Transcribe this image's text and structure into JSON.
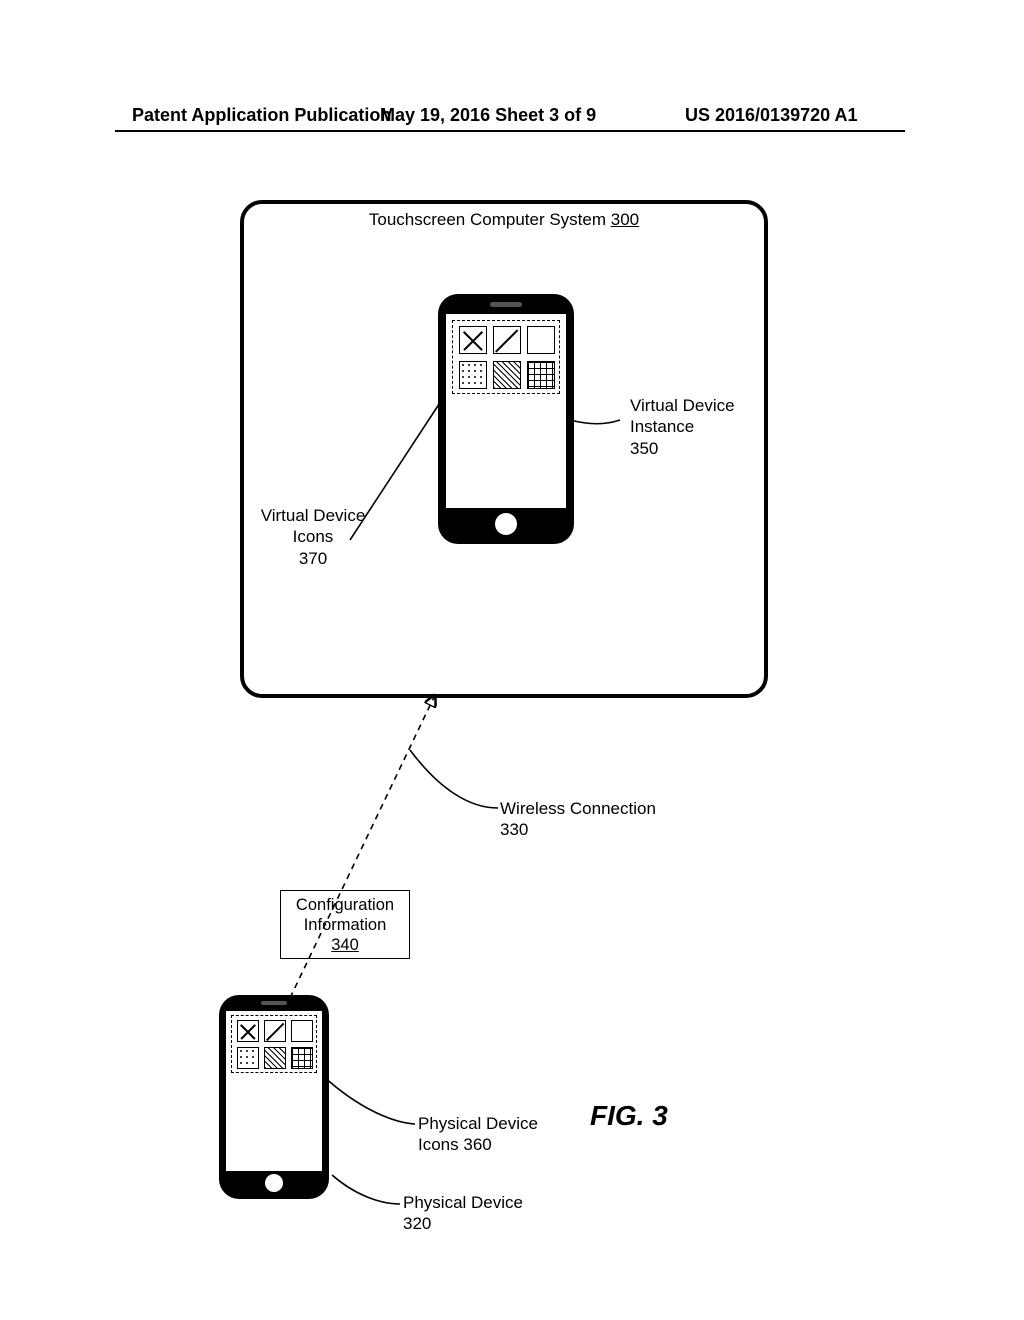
{
  "header": {
    "left": "Patent Application Publication",
    "mid": "May 19, 2016  Sheet 3 of 9",
    "right": "US 2016/0139720 A1"
  },
  "touchscreen": {
    "title_text": "Touchscreen Computer System",
    "title_ref": "300"
  },
  "labels": {
    "virtual_device_instance": {
      "text": "Virtual Device\nInstance",
      "ref": "350"
    },
    "virtual_device_icons": {
      "text": "Virtual Device\nIcons",
      "ref": "370"
    },
    "wireless_connection": {
      "text": "Wireless Connection",
      "ref": "330"
    },
    "configuration_info": {
      "text": "Configuration\nInformation",
      "ref": "340"
    },
    "physical_device_icons": {
      "text": "Physical Device\nIcons",
      "ref": "360"
    },
    "physical_device": {
      "text": "Physical Device",
      "ref": "320"
    }
  },
  "figure_caption": "FIG. 3",
  "icon_grid_layout": {
    "rows": 2,
    "cols": 3,
    "patterns": [
      "cross",
      "diag",
      "blank",
      "dots",
      "hatch",
      "grid"
    ]
  }
}
